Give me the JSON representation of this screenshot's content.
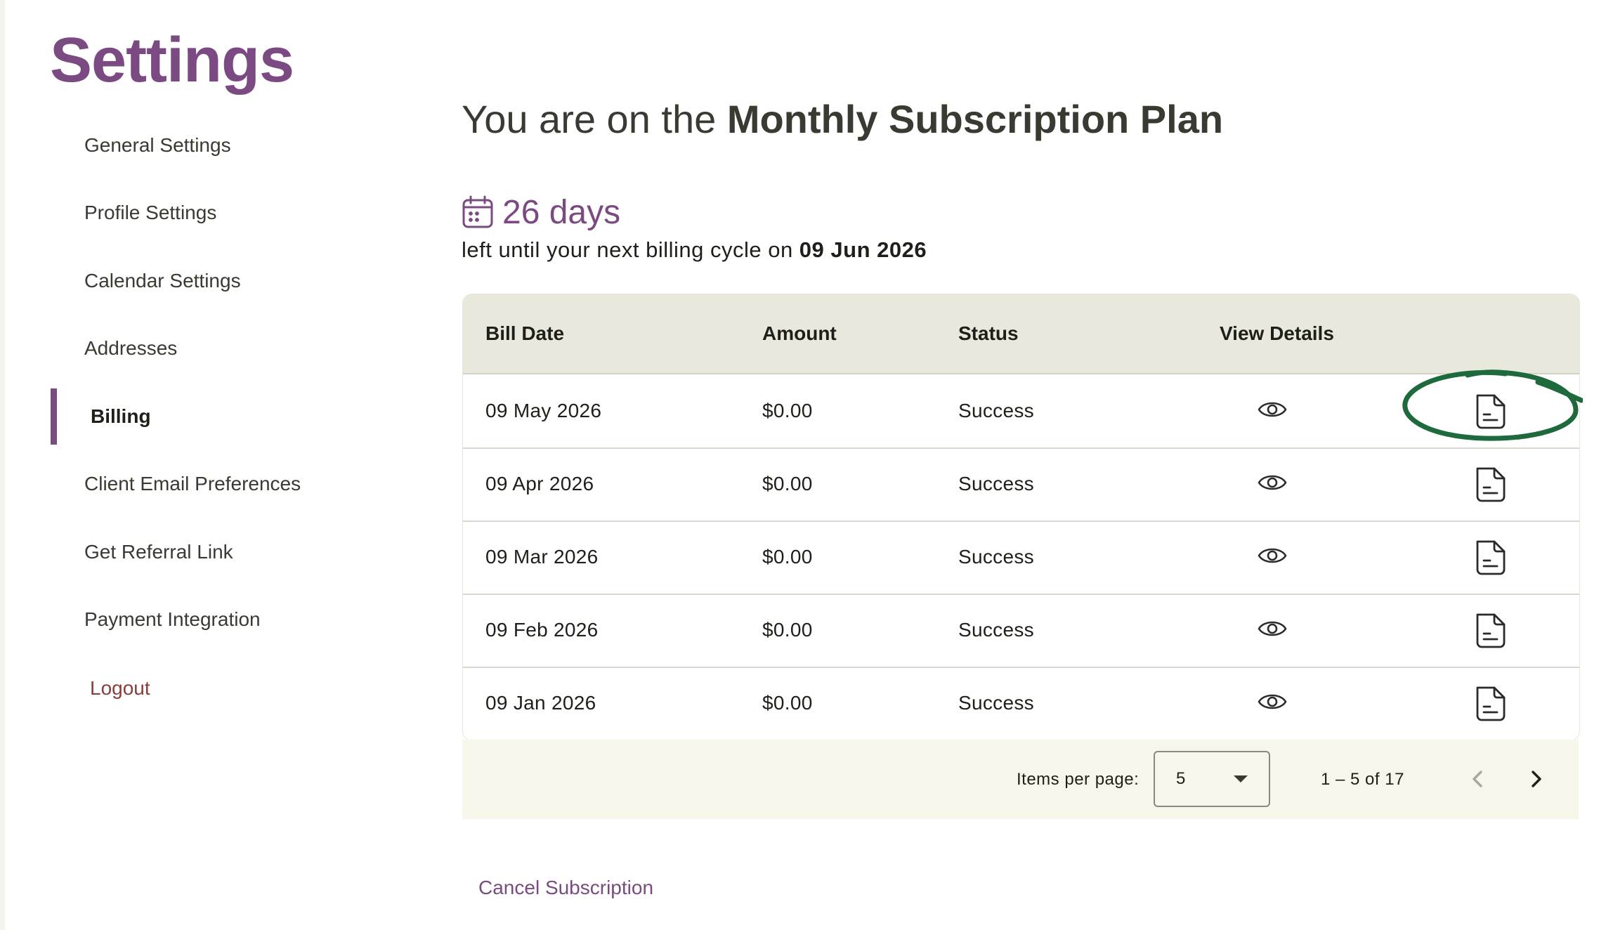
{
  "page_title": "Settings",
  "sidebar": {
    "items": [
      {
        "label": "General Settings"
      },
      {
        "label": "Profile Settings"
      },
      {
        "label": "Calendar Settings"
      },
      {
        "label": "Addresses"
      },
      {
        "label": "Billing",
        "active": true
      },
      {
        "label": "Client Email Preferences"
      },
      {
        "label": "Get Referral Link"
      },
      {
        "label": "Payment Integration"
      }
    ],
    "logout_label": "Logout"
  },
  "plan": {
    "prefix": "You are on the ",
    "name": "Monthly Subscription Plan"
  },
  "billing_cycle": {
    "days_left": "26 days",
    "text_prefix": "left until your next billing cycle on ",
    "next_date": "09 Jun 2026"
  },
  "table": {
    "headers": {
      "bill_date": "Bill Date",
      "amount": "Amount",
      "status": "Status",
      "view_details": "View Details"
    },
    "rows": [
      {
        "bill_date": "09 May 2026",
        "amount": "$0.00",
        "status": "Success"
      },
      {
        "bill_date": "09 Apr 2026",
        "amount": "$0.00",
        "status": "Success"
      },
      {
        "bill_date": "09 Mar 2026",
        "amount": "$0.00",
        "status": "Success"
      },
      {
        "bill_date": "09 Feb 2026",
        "amount": "$0.00",
        "status": "Success"
      },
      {
        "bill_date": "09 Jan 2026",
        "amount": "$0.00",
        "status": "Success"
      }
    ]
  },
  "paginator": {
    "items_per_page_label": "Items per page:",
    "page_size": "5",
    "range_label": "1 – 5 of 17"
  },
  "cancel_label": "Cancel Subscription",
  "icons": {
    "calendar": "calendar-icon",
    "view": "eye-icon",
    "invoice": "document-icon",
    "prev": "chevron-left-icon",
    "next": "chevron-right-icon",
    "dropdown": "caret-down-icon"
  },
  "colors": {
    "brand": "#7b4a82",
    "header_bg": "#e9e8dc",
    "paginator_bg": "#f7f6ea",
    "logout": "#8a3d3a",
    "annotation": "#1e6a3c"
  }
}
